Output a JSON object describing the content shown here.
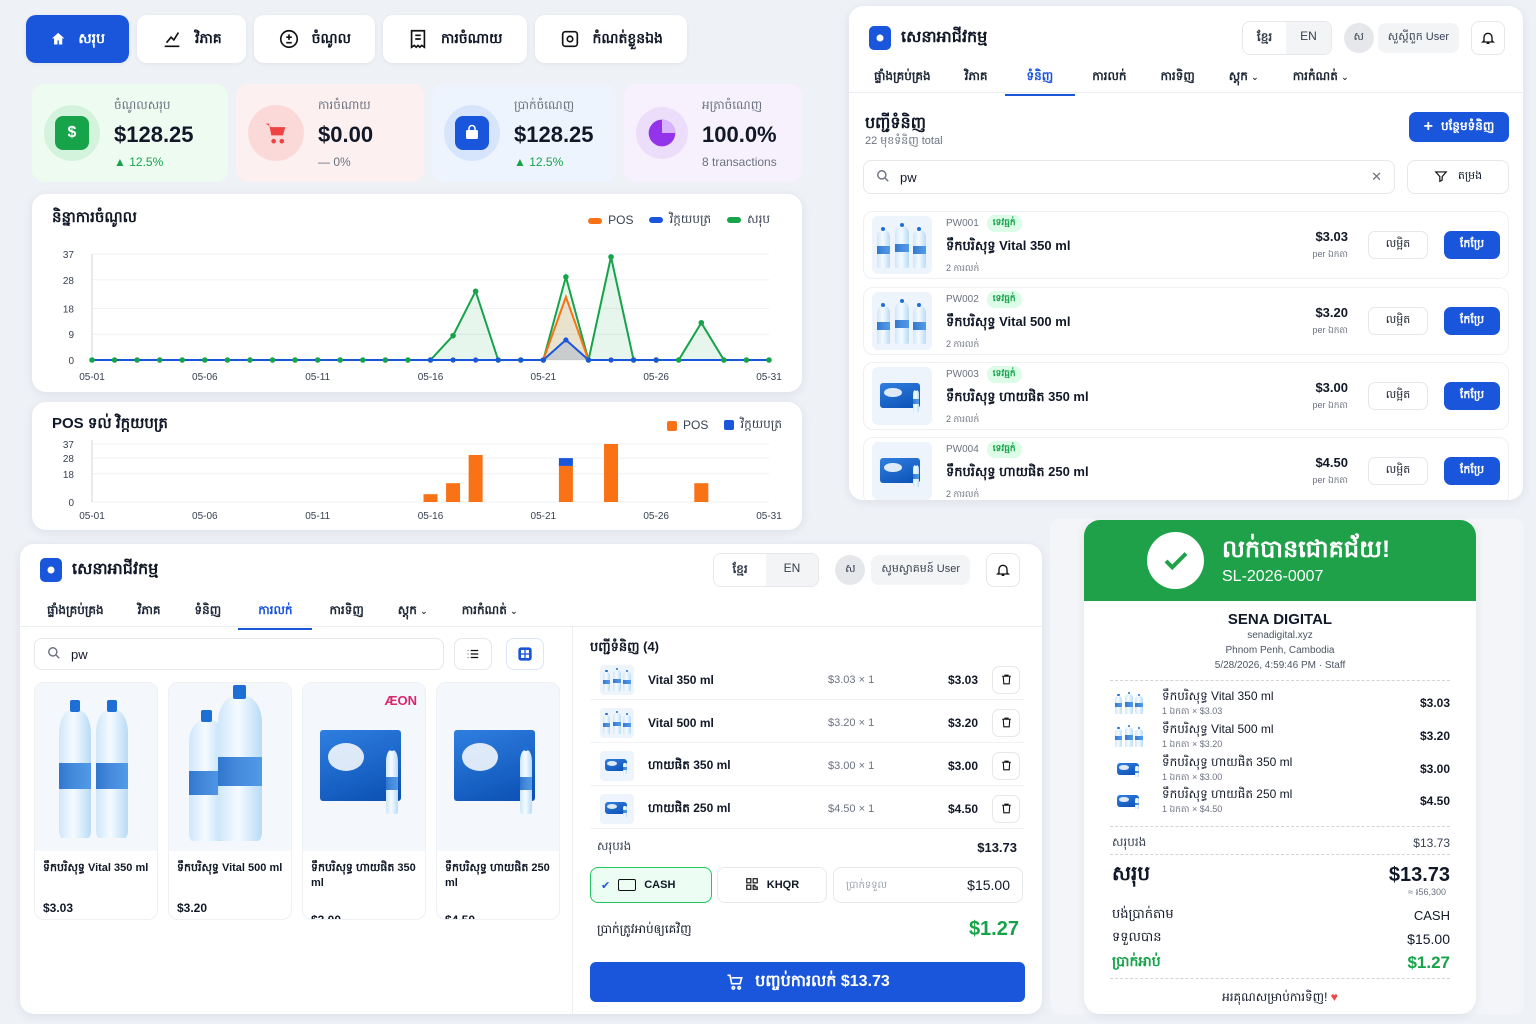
{
  "nav": {
    "items": [
      {
        "label": "សរុប",
        "icon": "home-icon",
        "active": true
      },
      {
        "label": "វិភាគ",
        "icon": "chart-line-icon",
        "active": false
      },
      {
        "label": "ចំណូល",
        "icon": "plus-minus-icon",
        "active": false
      },
      {
        "label": "ការចំណាយ",
        "icon": "receipt-icon",
        "active": false
      },
      {
        "label": "កំណត់ខ្លួនឯង",
        "icon": "settings-icon",
        "active": false
      }
    ]
  },
  "stats": [
    {
      "label": "ចំណូលសរុប",
      "value": "$128.25",
      "change": "12.5%",
      "trend": "up",
      "color": "#16a34a",
      "icon": "dollar-bag-icon"
    },
    {
      "label": "ការចំណាយ",
      "value": "$0.00",
      "change": "0%",
      "trend": "flat",
      "color": "#ef4444",
      "icon": "cart-icon"
    },
    {
      "label": "ប្រាក់ចំណេញ",
      "value": "$128.25",
      "change": "12.5%",
      "trend": "up",
      "color": "#1a56db",
      "icon": "wallet-icon"
    },
    {
      "label": "អត្រាចំណេញ",
      "value": "100.0%",
      "change": "8 transactions",
      "trend": "none",
      "color": "#9333ea",
      "icon": "pie-icon"
    }
  ],
  "chart_data": [
    {
      "type": "line",
      "title": "និន្នាការចំណូល",
      "x": [
        "05-01",
        "05-02",
        "05-03",
        "05-04",
        "05-05",
        "05-06",
        "05-07",
        "05-08",
        "05-09",
        "05-10",
        "05-11",
        "05-12",
        "05-13",
        "05-14",
        "05-15",
        "05-16",
        "05-17",
        "05-18",
        "05-19",
        "05-20",
        "05-21",
        "05-22",
        "05-23",
        "05-24",
        "05-25",
        "05-26",
        "05-27",
        "05-28",
        "05-29",
        "05-30",
        "05-31"
      ],
      "xticks": [
        "05-01",
        "05-06",
        "05-11",
        "05-16",
        "05-21",
        "05-26",
        "05-31"
      ],
      "yticks": [
        0,
        9,
        18,
        28,
        37
      ],
      "ylim": [
        0,
        37
      ],
      "series": [
        {
          "name": "POS",
          "color": "#f97316",
          "values": [
            0,
            0,
            0,
            0,
            0,
            0,
            0,
            0,
            0,
            0,
            0,
            0,
            0,
            0,
            0,
            0,
            0,
            0,
            0,
            0,
            0,
            22,
            0,
            0,
            0,
            0,
            0,
            0,
            0,
            0,
            0
          ]
        },
        {
          "name": "វិក្កយបត្រ",
          "color": "#1a56db",
          "values": [
            0,
            0,
            0,
            0,
            0,
            0,
            0,
            0,
            0,
            0,
            0,
            0,
            0,
            0,
            0,
            0,
            0,
            0,
            0,
            0,
            0,
            7,
            0,
            0,
            0,
            0,
            0,
            0,
            0,
            0,
            0
          ]
        },
        {
          "name": "សរុប",
          "color": "#16a34a",
          "values": [
            0,
            0,
            0,
            0,
            0,
            0,
            0,
            0,
            0,
            0,
            0,
            0,
            0,
            0,
            0,
            0,
            8.5,
            24,
            0,
            0,
            0,
            29,
            0,
            36,
            0,
            0,
            0,
            13,
            0,
            0,
            0
          ]
        }
      ]
    },
    {
      "type": "bar",
      "title": "POS ទល់ វិក្កយបត្រ",
      "x": [
        "05-01",
        "05-02",
        "05-03",
        "05-04",
        "05-05",
        "05-06",
        "05-07",
        "05-08",
        "05-09",
        "05-10",
        "05-11",
        "05-12",
        "05-13",
        "05-14",
        "05-15",
        "05-16",
        "05-17",
        "05-18",
        "05-19",
        "05-20",
        "05-21",
        "05-22",
        "05-23",
        "05-24",
        "05-25",
        "05-26",
        "05-27",
        "05-28",
        "05-29",
        "05-30",
        "05-31"
      ],
      "xticks": [
        "05-01",
        "05-06",
        "05-11",
        "05-16",
        "05-21",
        "05-26",
        "05-31"
      ],
      "yticks": [
        0,
        18,
        28,
        37
      ],
      "ylim": [
        0,
        37
      ],
      "stacked": true,
      "series": [
        {
          "name": "POS",
          "color": "#f97316",
          "values": [
            0,
            0,
            0,
            0,
            0,
            0,
            0,
            0,
            0,
            0,
            0,
            0,
            0,
            0,
            0,
            5,
            12,
            30,
            0,
            0,
            0,
            23,
            0,
            37,
            0,
            0,
            0,
            12,
            0,
            0,
            0
          ]
        },
        {
          "name": "វិក្កយបត្រ",
          "color": "#1a56db",
          "values": [
            0,
            0,
            0,
            0,
            0,
            0,
            0,
            0,
            0,
            0,
            0,
            0,
            0,
            0,
            0,
            0,
            0,
            0,
            0,
            0,
            0,
            5,
            0,
            0,
            0,
            0,
            0,
            0,
            0,
            0,
            0
          ]
        }
      ]
    }
  ],
  "catalog": {
    "brand": "សេនាអាជីវកម្ម",
    "lang": [
      "ខ្មែរ",
      "EN"
    ],
    "avatar": "ស",
    "user": "សួស្តីពួក User",
    "tabs": [
      "ផ្ទាំងគ្រប់គ្រង",
      "វិភាគ",
      "ទំនិញ",
      "ការលក់",
      "ការទិញ",
      "ស្តុក",
      "ការកំណត់"
    ],
    "active_tab": 2,
    "title": "បញ្ជីទំនិញ",
    "subtitle": "22 មុខទំនិញ total",
    "add_label": "បន្ថែមទំនិញ",
    "search_value": "pw",
    "filter_label": "តម្រង",
    "products": [
      {
        "code": "PW001",
        "badge": "ទេវធ្មក់",
        "name": "ទឹកបរិសុទ្ធ Vital 350 ml",
        "stock": "2 ការលក់",
        "price": "$3.03",
        "unit": "per ឯកតា",
        "img": "bottles"
      },
      {
        "code": "PW002",
        "badge": "ទេវធ្មក់",
        "name": "ទឹកបរិសុទ្ធ Vital 500 ml",
        "stock": "2 ការលក់",
        "price": "$3.20",
        "unit": "per ឯកតា",
        "img": "bottles"
      },
      {
        "code": "PW003",
        "badge": "ទេវធ្មក់",
        "name": "ទឹកបរិសុទ្ធ ហាយផិត 350 ml",
        "stock": "2 ការលក់",
        "price": "$3.00",
        "unit": "per ឯកតា",
        "img": "box"
      },
      {
        "code": "PW004",
        "badge": "ទេវធ្មក់",
        "name": "ទឹកបរិសុទ្ធ ហាយផិត 250 ml",
        "stock": "2 ការលក់",
        "price": "$4.50",
        "unit": "per ឯកតា",
        "img": "box"
      }
    ],
    "row_btn_view": "លម្អិត",
    "row_btn_edit": "កែប្រែ"
  },
  "pos": {
    "brand": "សេនាអាជីវកម្ម",
    "lang": [
      "ខ្មែរ",
      "EN"
    ],
    "avatar": "ស",
    "user": "សូមស្វាគមន៍ User",
    "tabs": [
      "ផ្ទាំងគ្រប់គ្រង",
      "វិភាគ",
      "ទំនិញ",
      "ការលក់",
      "ការទិញ",
      "ស្តុក",
      "ការកំណត់"
    ],
    "active_tab": 3,
    "search_value": "pw",
    "grid": [
      {
        "name": "ទឹកបរិសុទ្ធ Vital 350 ml",
        "price": "$3.03",
        "img": "bottles2"
      },
      {
        "name": "ទឹកបរិសុទ្ធ Vital 500 ml",
        "price": "$3.20",
        "img": "bottles2big"
      },
      {
        "name": "ទឹកបរិសុទ្ធ ហាយផិត 350 ml",
        "price": "$3.00",
        "img": "box",
        "brandmark": "ÆON"
      },
      {
        "name": "ទឹកបរិសុទ្ធ ហាយផិត 250 ml",
        "price": "$4.50",
        "img": "box"
      }
    ],
    "cart_title": "បញ្ជីទំនិញ (4)",
    "cart": [
      {
        "name": "Vital 350 ml",
        "qty": "$3.03 × 1",
        "sub": "$3.03",
        "img": "bottles"
      },
      {
        "name": "Vital 500 ml",
        "qty": "$3.20 × 1",
        "sub": "$3.20",
        "img": "bottles"
      },
      {
        "name": "ហាយផិត 350 ml",
        "qty": "$3.00 × 1",
        "sub": "$3.00",
        "img": "box"
      },
      {
        "name": "ហាយផិត 250 ml",
        "qty": "$4.50 × 1",
        "sub": "$4.50",
        "img": "box"
      }
    ],
    "subtotal_label": "សរុបរង",
    "subtotal": "$13.73",
    "pay_cash": "CASH",
    "pay_khqr": "KHQR",
    "received_label": "ប្រាក់ទទួល",
    "received": "$15.00",
    "change_label": "ប្រាក់ត្រូវអាប់ឲ្យគេវិញ",
    "change": "$1.27",
    "checkout": "បញ្ចប់ការលក់ $13.73"
  },
  "receipt": {
    "title": "លក់បានជោគជ័យ!",
    "number": "SL-2026-0007",
    "shop": "SENA DIGITAL",
    "web": "senadigital.xyz",
    "city": "Phnom Penh, Cambodia",
    "meta": "5/28/2026, 4:59:46 PM · Staff",
    "items": [
      {
        "name": "ទឹកបរិសុទ្ធ Vital 350 ml",
        "qty": "1 ឯកតា × $3.03",
        "sub": "$3.03",
        "img": "bottles"
      },
      {
        "name": "ទឹកបរិសុទ្ធ Vital 500 ml",
        "qty": "1 ឯកតា × $3.20",
        "sub": "$3.20",
        "img": "bottles"
      },
      {
        "name": "ទឹកបរិសុទ្ធ ហាយផិត 350 ml",
        "qty": "1 ឯកតា × $3.00",
        "sub": "$3.00",
        "img": "box"
      },
      {
        "name": "ទឹកបរិសុទ្ធ ហាយផិត 250 ml",
        "qty": "1 ឯកតា × $4.50",
        "sub": "$4.50",
        "img": "box"
      }
    ],
    "subtotal_label": "សរុបរង",
    "subtotal": "$13.73",
    "total_label": "សរុប",
    "total": "$13.73",
    "total_riel": "≈ ៛56,300",
    "method_label": "បង់ប្រាក់តាម",
    "method": "CASH",
    "received_label": "ទទួលបាន",
    "received": "$15.00",
    "change_label": "ប្រាក់អាប់",
    "change": "$1.27",
    "thanks": "អរគុណសម្រាប់ការទិញ!"
  }
}
